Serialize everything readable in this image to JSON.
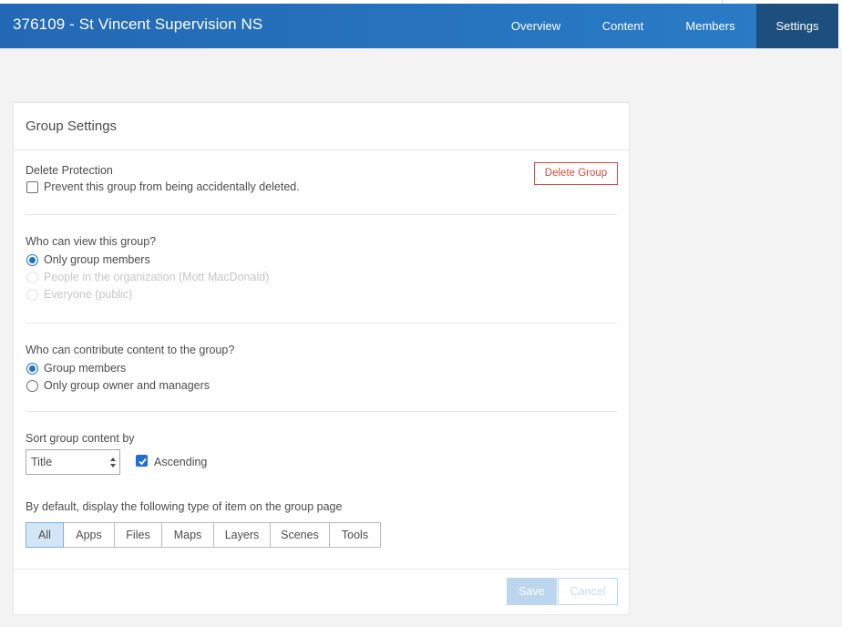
{
  "header": {
    "title": "376109 - St Vincent Supervision NS",
    "tabs": [
      {
        "label": "Overview",
        "active": false
      },
      {
        "label": "Content",
        "active": false
      },
      {
        "label": "Members",
        "active": false
      },
      {
        "label": "Settings",
        "active": true
      }
    ]
  },
  "settings": {
    "title": "Group Settings",
    "delete_protection": {
      "heading": "Delete Protection",
      "checkbox_label": "Prevent this group from being accidentally deleted.",
      "checked": false,
      "delete_button": "Delete Group"
    },
    "view_access": {
      "question": "Who can view this group?",
      "options": [
        {
          "label": "Only group members",
          "selected": true,
          "disabled": false
        },
        {
          "label": "People in the organization (Mott MacDonald)",
          "selected": false,
          "disabled": true
        },
        {
          "label": "Everyone (public)",
          "selected": false,
          "disabled": true
        }
      ]
    },
    "contribute_access": {
      "question": "Who can contribute content to the group?",
      "options": [
        {
          "label": "Group members",
          "selected": true
        },
        {
          "label": "Only group owner and managers",
          "selected": false
        }
      ]
    },
    "sort": {
      "label": "Sort group content by",
      "selected": "Title",
      "ascending_label": "Ascending",
      "ascending_checked": true
    },
    "display": {
      "label": "By default, display the following type of item on the group page",
      "types": [
        "All",
        "Apps",
        "Files",
        "Maps",
        "Layers",
        "Scenes",
        "Tools"
      ],
      "active": "All"
    },
    "save_label": "Save",
    "cancel_label": "Cancel"
  },
  "colors": {
    "header": "#2471bc",
    "active_tab": "#1d4f7e",
    "accent": "#1f6fd1",
    "danger": "#c94c3a"
  }
}
